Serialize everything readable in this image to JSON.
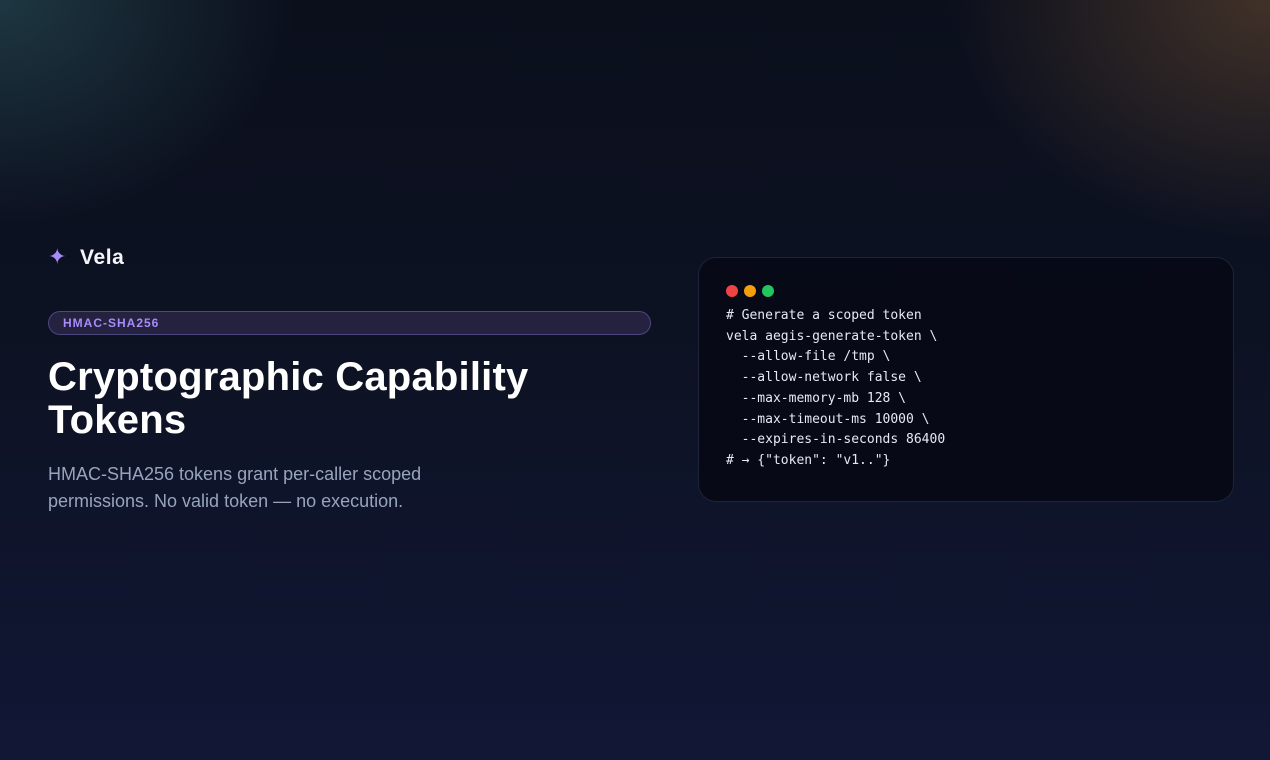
{
  "brand": {
    "icon": "sparkle-icon",
    "icon_glyph": "✦",
    "name": "Vela"
  },
  "hero": {
    "badge": "HMAC-SHA256",
    "title_line1": "Cryptographic Capability",
    "title_line2": "Tokens",
    "subtitle": "HMAC-SHA256 tokens grant per-caller scoped permissions. No valid token — no execution."
  },
  "terminal": {
    "window_dots": [
      "red",
      "yellow",
      "green"
    ],
    "lines": [
      "# Generate a scoped token",
      "vela aegis-generate-token \\",
      "  --allow-file /tmp \\",
      "  --allow-network false \\",
      "  --max-memory-mb 128 \\",
      "  --max-timeout-ms 10000 \\",
      "  --expires-in-seconds 86400",
      "# → {\"token\": \"v1..\"}"
    ]
  },
  "colors": {
    "accent": "#a78bfa",
    "dot_red": "#ef4444",
    "dot_yellow": "#f59e0b",
    "dot_green": "#22c55e"
  }
}
